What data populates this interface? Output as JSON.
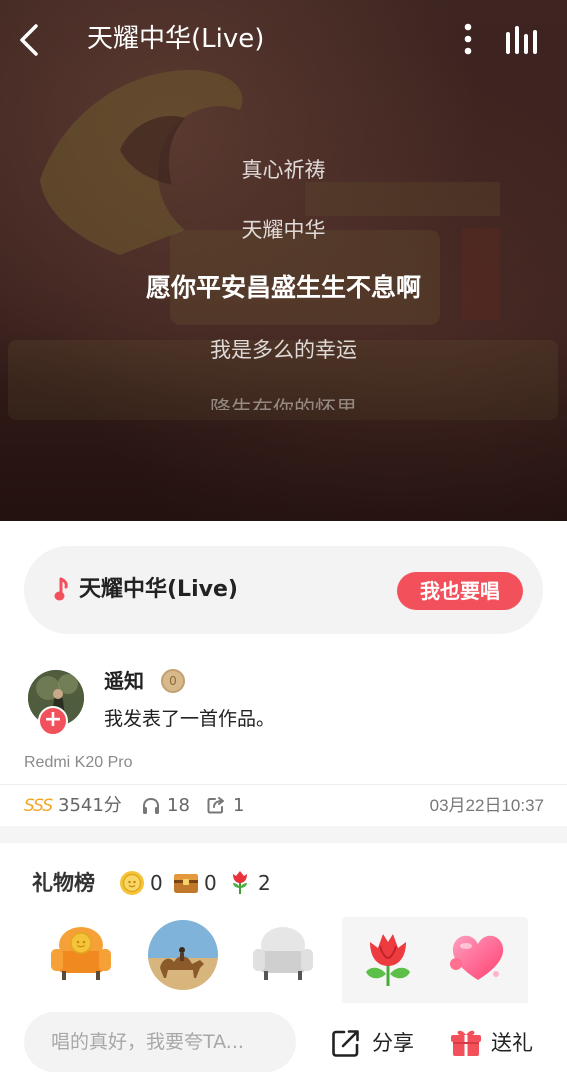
{
  "header": {
    "song_title": "天耀中华(Live)"
  },
  "lyrics": {
    "lines": [
      "真心祈祷",
      "天耀中华",
      "愿你平安昌盛生生不息啊",
      "我是多么的幸运",
      "降生在你的怀里"
    ],
    "active_index": 2
  },
  "song_card": {
    "title": "天耀中华(Live)",
    "sing_button": "我也要唱"
  },
  "post": {
    "username": "遥知",
    "level": "0",
    "content": "我发表了一首作品。",
    "device": "Redmi K20 Pro",
    "grade": "SSS",
    "score": "3541分",
    "listens": "18",
    "shares": "1",
    "time": "03月22日10:37"
  },
  "gifts": {
    "title": "礼物榜",
    "coins": "0",
    "chests": "0",
    "flowers": "2"
  },
  "bottom": {
    "comment_placeholder": "唱的真好，我要夸TA...",
    "share_label": "分享",
    "gift_label": "送礼"
  },
  "colors": {
    "accent": "#f2515c",
    "grade": "#f3a624"
  }
}
